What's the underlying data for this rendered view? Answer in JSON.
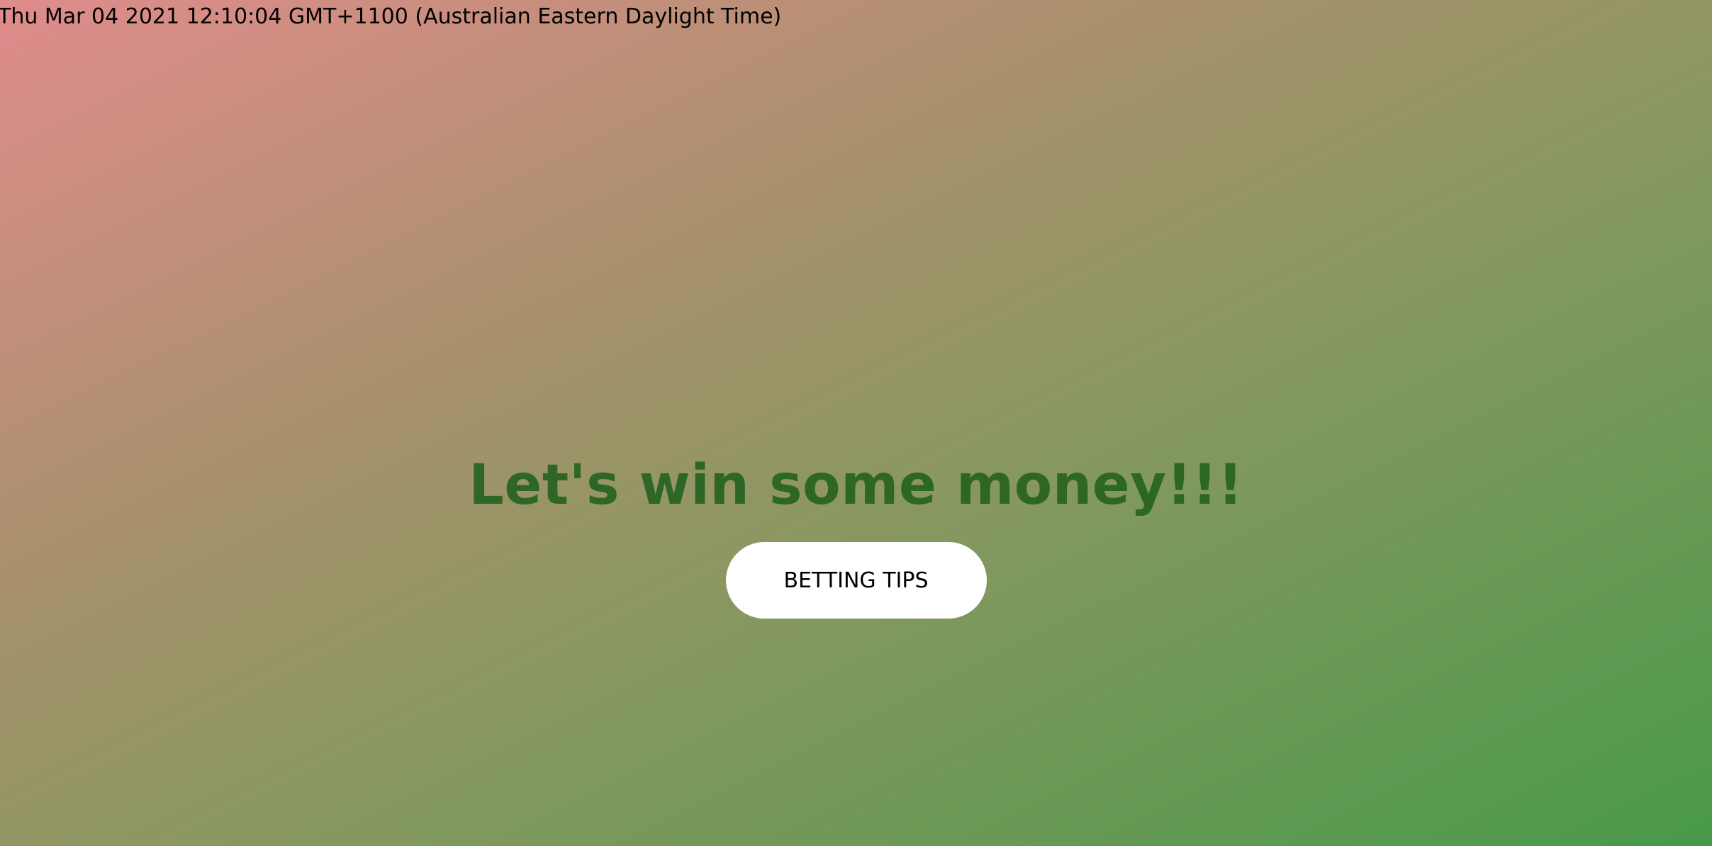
{
  "header": {
    "datetime": "Thu Mar 04 2021 12:10:04 GMT+1100 (Australian Eastern Daylight Time)"
  },
  "main": {
    "headline": "Let's win some money!!!",
    "cta_label": "BETTING TIPS"
  },
  "colors": {
    "gradient_start": "#e08c8c",
    "gradient_end": "#48994a",
    "headline": "#2e6626",
    "button_bg": "#ffffff"
  }
}
